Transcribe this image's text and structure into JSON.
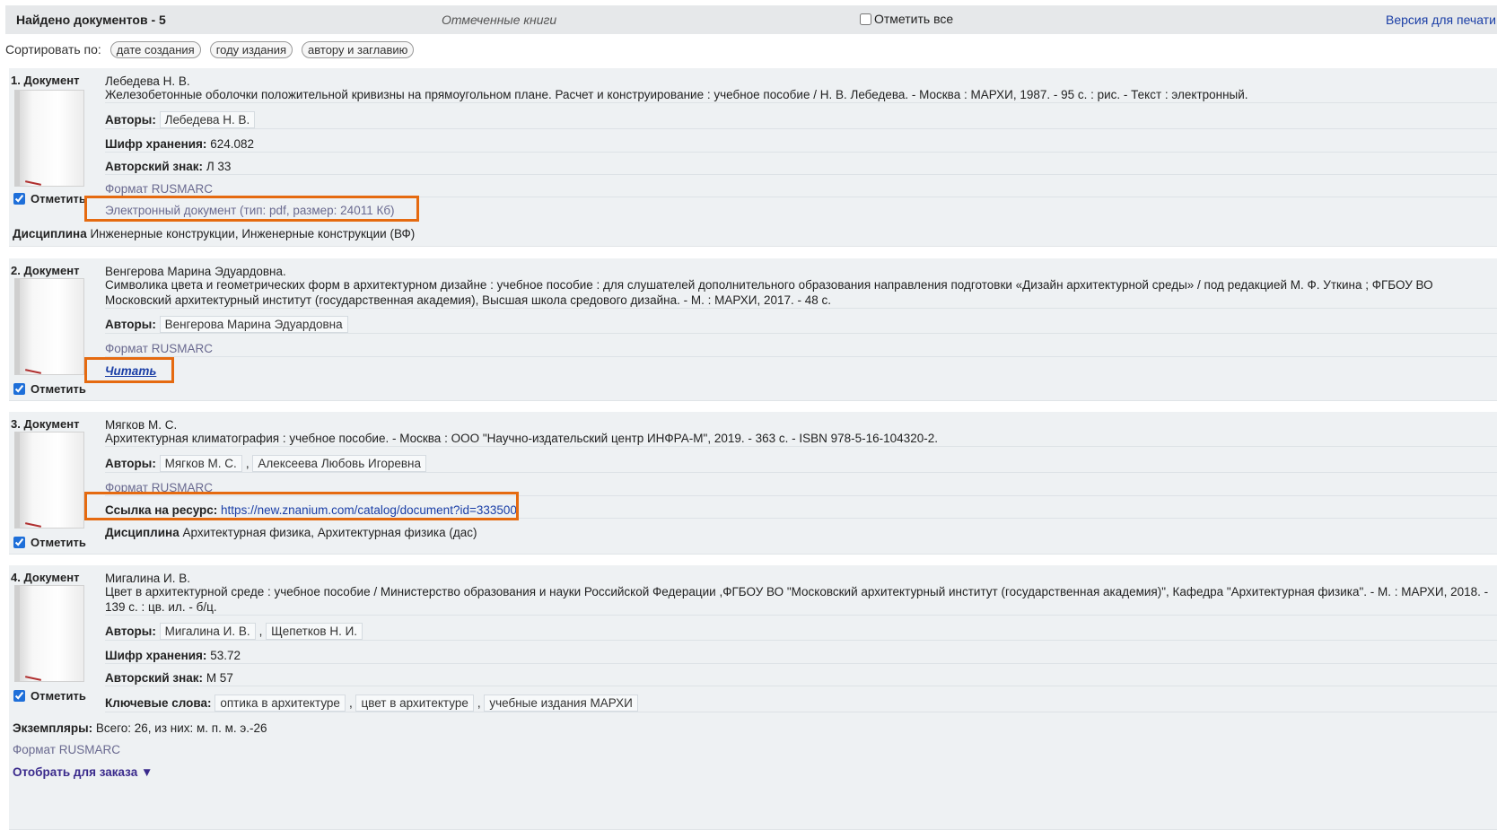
{
  "header": {
    "found": "Найдено документов - 5",
    "marked_books": "Отмеченные книги",
    "mark_all": "Отметить все",
    "print_version": "Версия для печати"
  },
  "sort": {
    "label": "Сортировать по:",
    "options": [
      "дате создания",
      "году издания",
      "автору и заглавию"
    ]
  },
  "documents": [
    {
      "num": "1. Документ",
      "mark": "Отметить",
      "author_line": "Лебедева Н. В.",
      "description": "Железобетонные оболочки положительной кривизны на прямоугольном плане. Расчет и конструирование : учебное пособие / Н. В. Лебедева. - Москва : МАРХИ, 1987. - 95 с. : рис. - Текст : электронный.",
      "authors_label": "Авторы:",
      "authors": [
        "Лебедева Н. В."
      ],
      "shelf_label": "Шифр хранения:",
      "shelf": "624.082",
      "author_mark_label": "Авторский знак:",
      "author_mark": "Л 33",
      "format": "Формат RUSMARC",
      "edoc": "Электронный документ (тип: pdf, размер: 24011 Кб)",
      "disc_label": "Дисциплина",
      "disc": "Инженерные конструкции, Инженерные конструкции (ВФ)"
    },
    {
      "num": "2. Документ",
      "mark": "Отметить",
      "author_line": "Венгерова Марина Эдуардовна.",
      "description": "Символика цвета и геометрических форм в архитектурном дизайне : учебное пособие : для слушателей дополнительного образования направления подготовки «Дизайн архитектурной среды» / под редакцией М. Ф. Уткина ; ФГБОУ ВО Московский архитектурный институт (государственная академия), Высшая школа средового дизайна. - М. : МАРХИ, 2017. - 48 с.",
      "authors_label": "Авторы:",
      "authors": [
        "Венгерова Марина Эдуардовна"
      ],
      "format": "Формат RUSMARC",
      "read": "Читать"
    },
    {
      "num": "3. Документ",
      "mark": "Отметить",
      "author_line": "Мягков М. С.",
      "description": "Архитектурная климатография : учебное пособие. - Москва : ООО \"Научно-издательский центр ИНФРА-М\", 2019. - 363 с. - ISBN 978-5-16-104320-2.",
      "authors_label": "Авторы:",
      "authors": [
        "Мягков М. С.",
        "Алексеева Любовь Игоревна"
      ],
      "format": "Формат RUSMARC",
      "link_label": "Ссылка на ресурс:",
      "link": "https://new.znanium.com/catalog/document?id=333500",
      "disc_label": "Дисциплина",
      "disc": "Архитектурная физика, Архитектурная физика (дас)"
    },
    {
      "num": "4. Документ",
      "mark": "Отметить",
      "author_line": "Мигалина И. В.",
      "description": "Цвет в архитектурной среде : учебное пособие / Министерство образования и науки Российской Федерации ,ФГБОУ ВО \"Московский архитектурный институт (государственная академия)\", Кафедра \"Архитектурная физика\". - М. : МАРХИ, 2018. - 139 с. : цв. ил. - б/ц.",
      "authors_label": "Авторы:",
      "authors": [
        "Мигалина И. В.",
        "Щепетков Н. И."
      ],
      "shelf_label": "Шифр хранения:",
      "shelf": "53.72",
      "author_mark_label": "Авторский знак:",
      "author_mark": "М 57",
      "keywords_label": "Ключевые слова:",
      "keywords": [
        "оптика в архитектуре",
        "цвет в архитектуре",
        "учебные издания МАРХИ"
      ],
      "copies_label": "Экземпляры:",
      "copies": "Всего: 26, из них: м. п. м. э.-26",
      "format": "Формат RUSMARC",
      "order": "Отобрать для заказа ▼"
    }
  ]
}
